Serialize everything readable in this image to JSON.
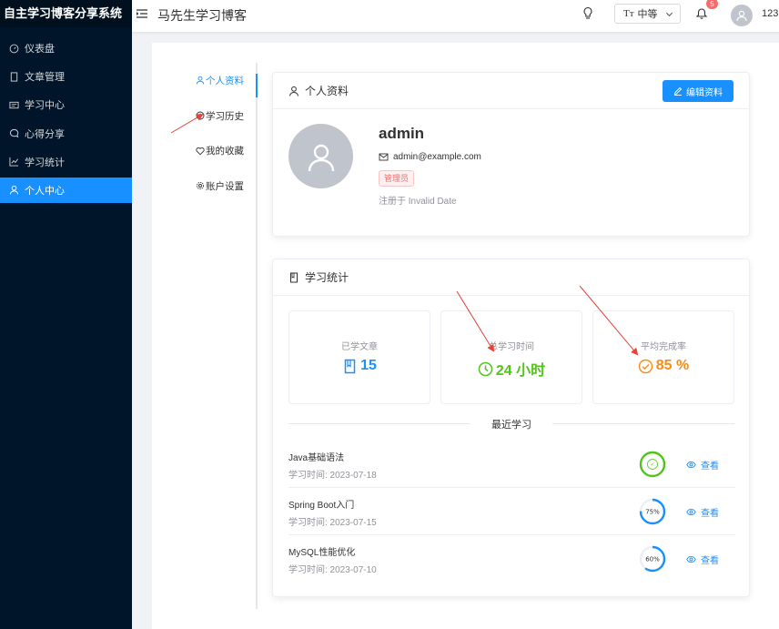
{
  "app": {
    "brand": "自主学习博客分享系统"
  },
  "sidebar": {
    "items": [
      {
        "label": "仪表盘",
        "icon": "gauge-icon"
      },
      {
        "label": "文章管理",
        "icon": "document-icon"
      },
      {
        "label": "学习中心",
        "icon": "reader-icon"
      },
      {
        "label": "心得分享",
        "icon": "chat-icon"
      },
      {
        "label": "学习统计",
        "icon": "trend-icon"
      },
      {
        "label": "个人中心",
        "icon": "user-icon",
        "active": true
      }
    ]
  },
  "header": {
    "title": "马先生学习博客",
    "font_size_icon": "Tт",
    "font_size": "中等",
    "notification_count": "5",
    "username": "123"
  },
  "sub_nav": {
    "items": [
      {
        "label": "个人资料",
        "icon": "user-icon",
        "active": true
      },
      {
        "label": "学习历史",
        "icon": "clock-icon"
      },
      {
        "label": "我的收藏",
        "icon": "heart-icon"
      },
      {
        "label": "账户设置",
        "icon": "gear-icon"
      }
    ]
  },
  "profile": {
    "title": "个人资料",
    "edit_label": "编辑资料",
    "name": "admin",
    "email": "admin@example.com",
    "role": "管理员",
    "registered": "注册于 Invalid Date"
  },
  "stats": {
    "title": "学习统计",
    "boxes": [
      {
        "label": "已学文章",
        "value": "15",
        "color": "#1890ff",
        "icon": "book-icon"
      },
      {
        "label": "总学习时间",
        "value": "24 小时",
        "color": "#52c41a",
        "icon": "clock-icon"
      },
      {
        "label": "平均完成率",
        "value": "85 %",
        "color": "#fa8c16",
        "icon": "check-circle-icon"
      }
    ],
    "recent_title": "最近学习",
    "view_label": "查看",
    "recent": [
      {
        "title": "Java基础语法",
        "time": "学习时间: 2023-07-18",
        "progress": 100,
        "progress_label": "✓",
        "color": "#52c41a"
      },
      {
        "title": "Spring Boot入门",
        "time": "学习时间: 2023-07-15",
        "progress": 75,
        "progress_label": "75%",
        "color": "#1890ff"
      },
      {
        "title": "MySQL性能优化",
        "time": "学习时间: 2023-07-10",
        "progress": 60,
        "progress_label": "60%",
        "color": "#1890ff"
      }
    ]
  },
  "colors": {
    "primary": "#1890ff",
    "sidebar_bg": "#001529",
    "annotation": "#e8433a"
  }
}
